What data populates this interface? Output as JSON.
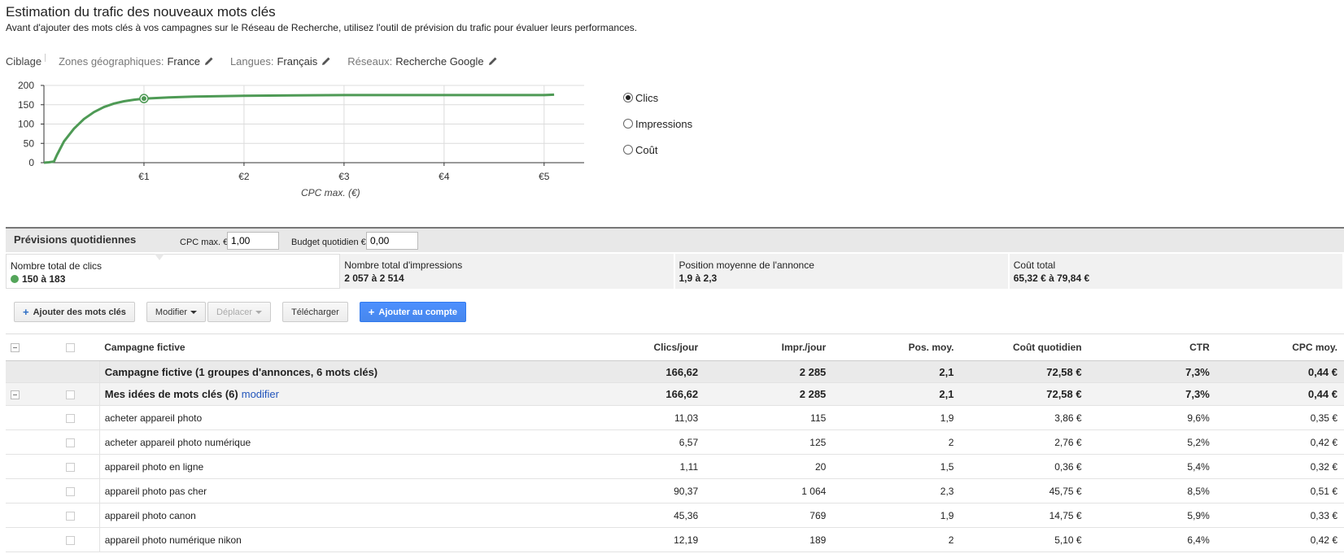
{
  "header": {
    "title": "Estimation du trafic des nouveaux mots clés",
    "subtitle": "Avant d'ajouter des mots clés à vos campagnes sur le Réseau de Recherche, utilisez l'outil de prévision du trafic pour évaluer leurs performances."
  },
  "targeting": {
    "label": "Ciblage",
    "items": [
      {
        "key": "Zones géographiques:",
        "value": "France"
      },
      {
        "key": "Langues:",
        "value": "Français"
      },
      {
        "key": "Réseaux:",
        "value": "Recherche Google"
      }
    ]
  },
  "metrics": {
    "options": [
      "Clics",
      "Impressions",
      "Coût"
    ],
    "selected": "Clics"
  },
  "chart_data": {
    "type": "line",
    "xlabel": "CPC max. (€)",
    "ylabel": "",
    "xlim": [
      0,
      5.4
    ],
    "ylim": [
      0,
      200
    ],
    "xticks": [
      1,
      2,
      3,
      4,
      5
    ],
    "xtick_labels": [
      "€1",
      "€2",
      "€3",
      "€4",
      "€5"
    ],
    "yticks": [
      0,
      50,
      100,
      150,
      200
    ],
    "ytick_labels": [
      "0",
      "50",
      "100",
      "150",
      "200"
    ],
    "grid": true,
    "series": [
      {
        "color": "#4e9a55",
        "x": [
          0,
          0.05,
          0.1,
          0.13,
          0.2,
          0.3,
          0.4,
          0.5,
          0.6,
          0.7,
          0.8,
          0.9,
          1.0,
          1.25,
          1.5,
          2.0,
          2.5,
          3.0,
          3.5,
          4.0,
          4.5,
          5.0,
          5.1
        ],
        "y": [
          0,
          1,
          3,
          20,
          55,
          88,
          113,
          131,
          144,
          153,
          159,
          163,
          166,
          169,
          171,
          173,
          174,
          175,
          175,
          175,
          175,
          175,
          176
        ]
      }
    ],
    "marker": {
      "x": 1.0,
      "y": 166
    }
  },
  "forecast": {
    "title": "Prévisions quotidiennes",
    "cpc_label": "CPC max. €",
    "cpc_value": "1,00",
    "budget_label": "Budget quotidien €",
    "budget_value": "0,00"
  },
  "stats": [
    {
      "label": "Nombre total de clics",
      "value": "150 à 183"
    },
    {
      "label": "Nombre total d'impressions",
      "value": "2 057 à 2 514"
    },
    {
      "label": "Position moyenne de l'annonce",
      "value": "1,9 à 2,3"
    },
    {
      "label": "Coût total",
      "value": "65,32 € à 79,84 €"
    }
  ],
  "toolbar": {
    "add_keywords": "Ajouter des mots clés",
    "modify": "Modifier",
    "move": "Déplacer",
    "download": "Télécharger",
    "add_to_account": "Ajouter au compte"
  },
  "table": {
    "columns": [
      "Campagne fictive",
      "Clics/jour",
      "Impr./jour",
      "Pos. moy.",
      "Coût quotidien",
      "CTR",
      "CPC moy."
    ],
    "campaign": {
      "name": "Campagne fictive (1 groupes d'annonces, 6 mots clés)",
      "values": [
        "166,62",
        "2 285",
        "2,1",
        "72,58 €",
        "7,3%",
        "0,44 €"
      ]
    },
    "group": {
      "name": "Mes idées de mots clés (6)",
      "link": "modifier",
      "values": [
        "166,62",
        "2 285",
        "2,1",
        "72,58 €",
        "7,3%",
        "0,44 €"
      ]
    },
    "rows": [
      {
        "keyword": "acheter appareil photo",
        "values": [
          "11,03",
          "115",
          "1,9",
          "3,86 €",
          "9,6%",
          "0,35 €"
        ]
      },
      {
        "keyword": "acheter appareil photo numérique",
        "values": [
          "6,57",
          "125",
          "2",
          "2,76 €",
          "5,2%",
          "0,42 €"
        ]
      },
      {
        "keyword": "appareil photo en ligne",
        "values": [
          "1,11",
          "20",
          "1,5",
          "0,36 €",
          "5,4%",
          "0,32 €"
        ]
      },
      {
        "keyword": "appareil photo pas cher",
        "values": [
          "90,37",
          "1 064",
          "2,3",
          "45,75 €",
          "8,5%",
          "0,51 €"
        ]
      },
      {
        "keyword": "appareil photo canon",
        "values": [
          "45,36",
          "769",
          "1,9",
          "14,75 €",
          "5,9%",
          "0,33 €"
        ]
      },
      {
        "keyword": "appareil photo numérique nikon",
        "values": [
          "12,19",
          "189",
          "2",
          "5,10 €",
          "6,4%",
          "0,42 €"
        ]
      }
    ]
  }
}
